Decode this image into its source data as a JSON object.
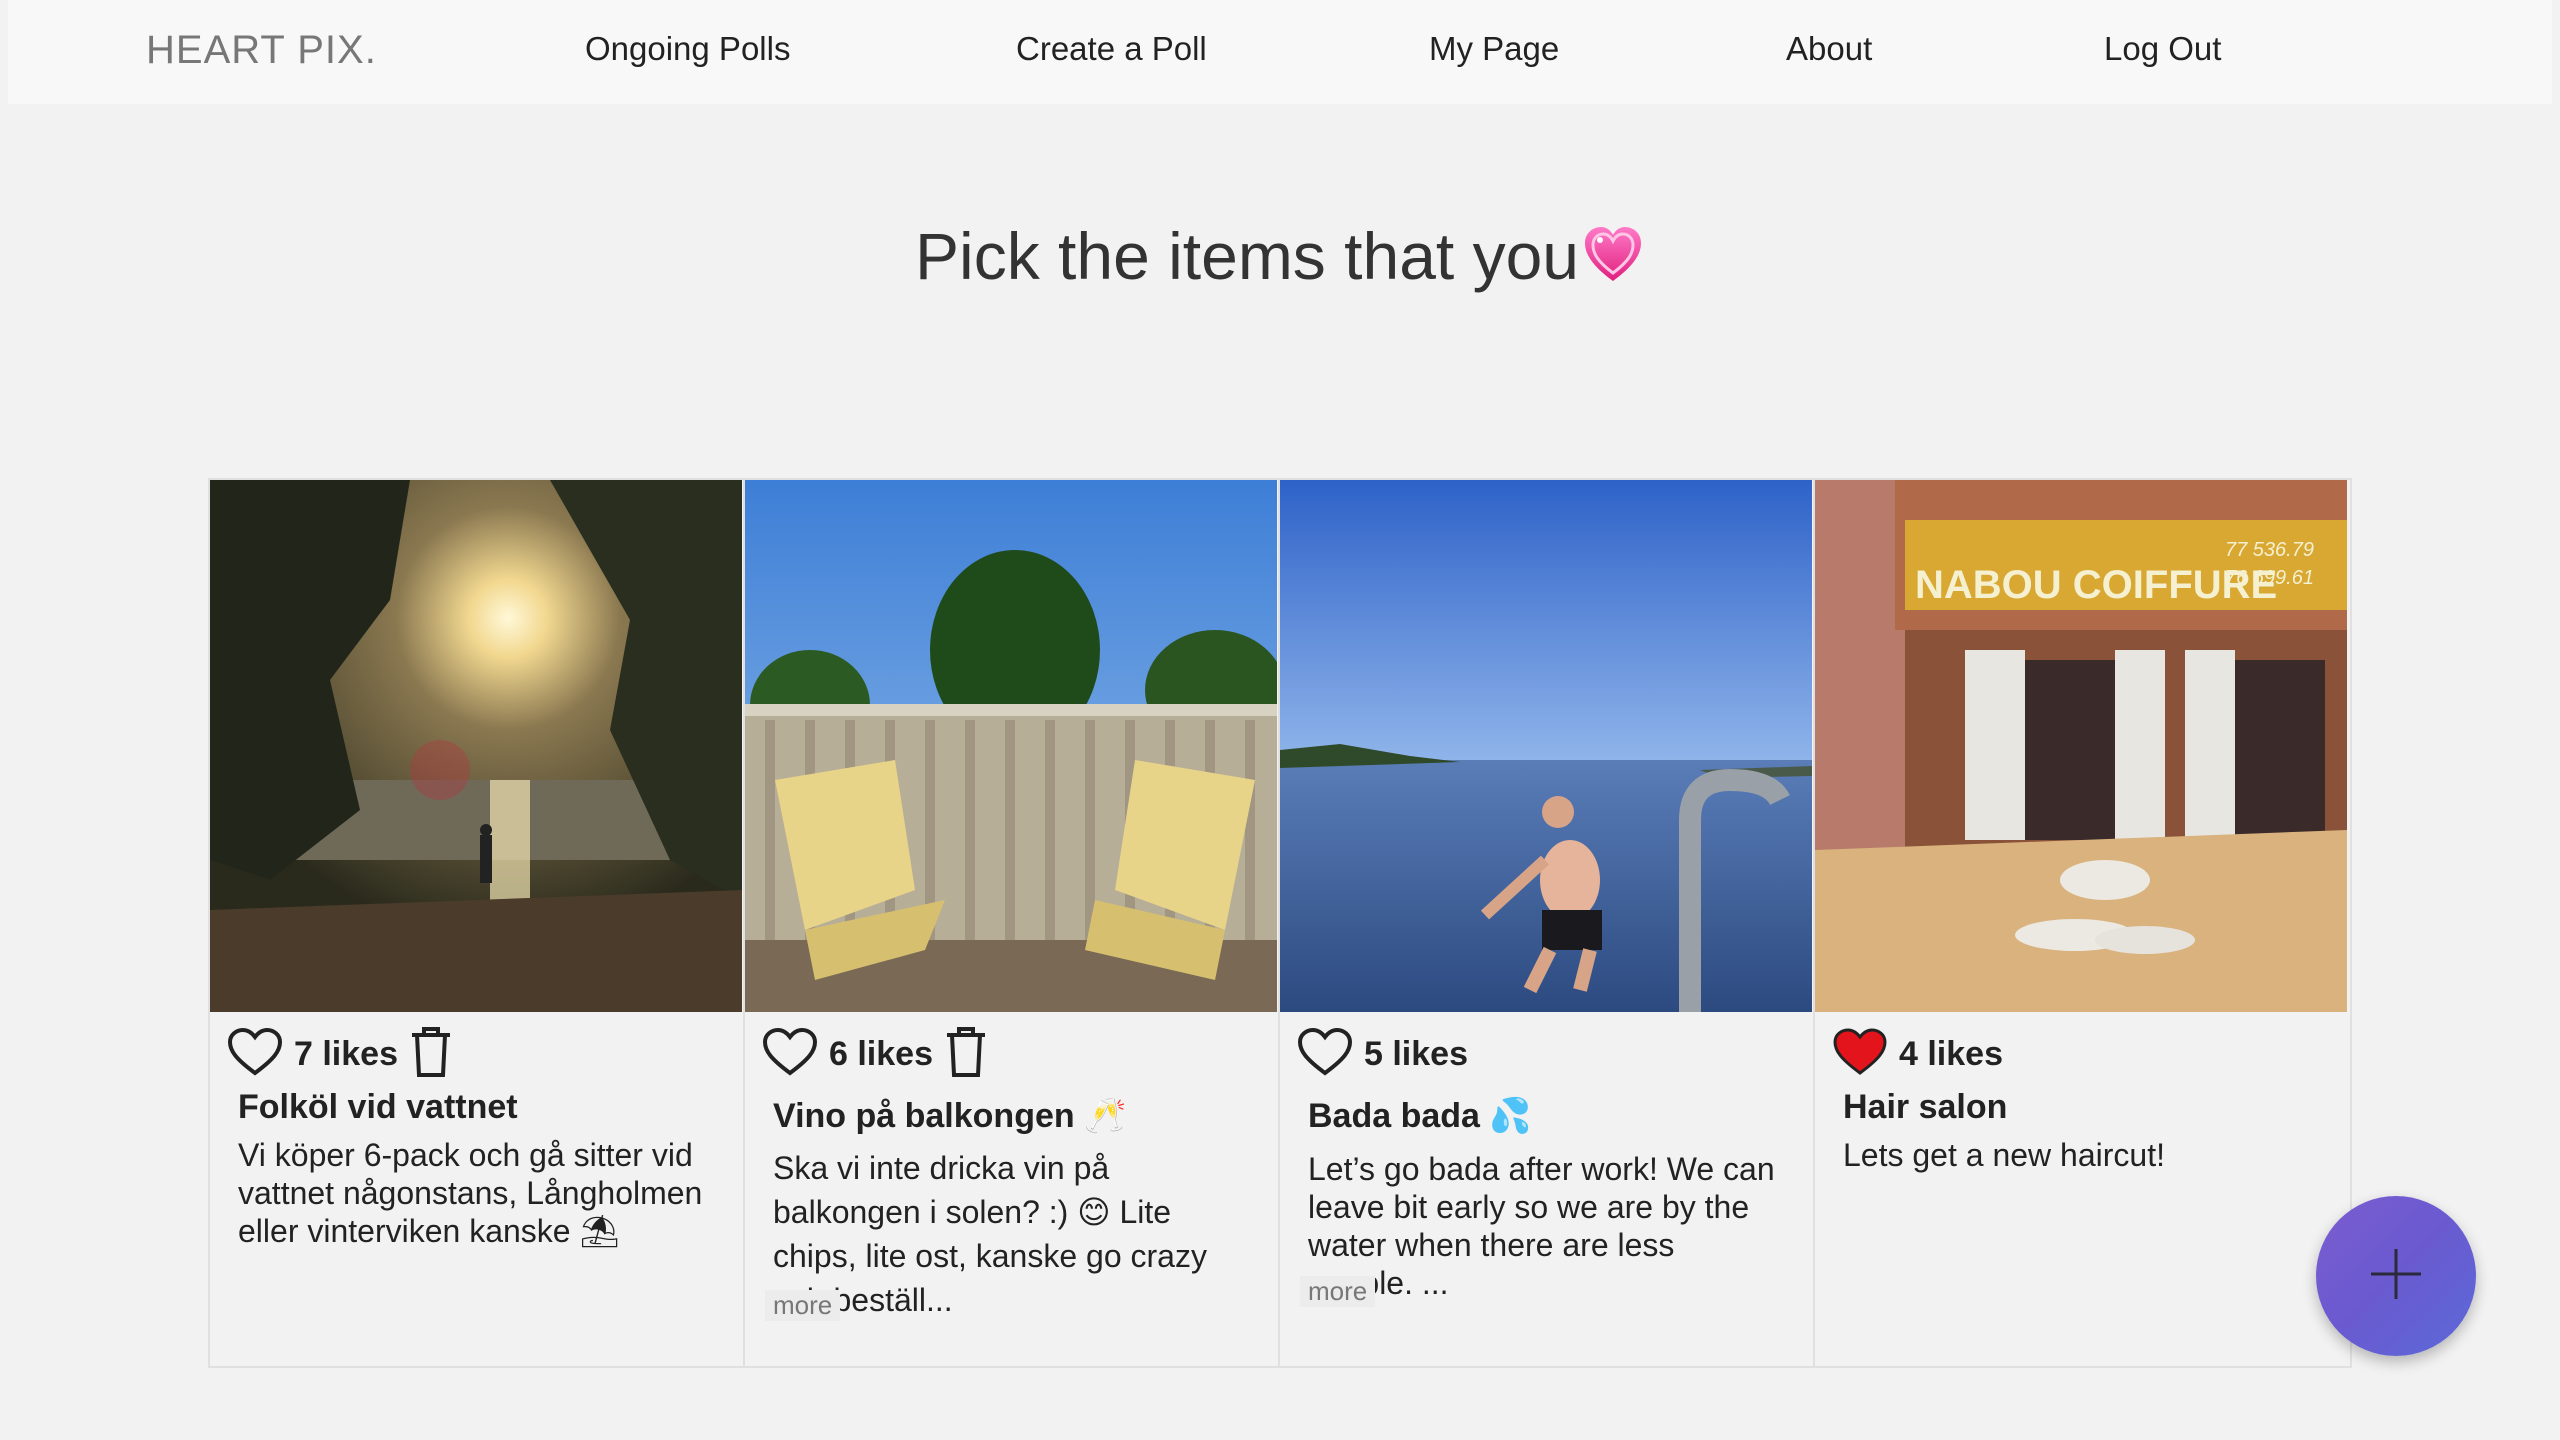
{
  "nav": {
    "brand": "HEART PIX.",
    "links": [
      "Ongoing Polls",
      "Create a Poll",
      "My Page",
      "About",
      "Log Out"
    ]
  },
  "page_title": "Pick the items that you",
  "cards": [
    {
      "likes": "7 likes",
      "liked": false,
      "deletable": true,
      "title": "Folköl vid vattnet",
      "description": "Vi köper 6-pack och gå sitter vid vattnet någonstans, Långholmen eller vinterviken kanske ⛱",
      "more": ""
    },
    {
      "likes": "6 likes",
      "liked": false,
      "deletable": true,
      "title": "Vino på balkongen 🥂",
      "description": "Ska vi inte dricka vin på balkongen i solen? :) 😊 Lite chips, lite ost, kanske go crazy och beställ...",
      "more": "more"
    },
    {
      "likes": "5 likes",
      "liked": false,
      "deletable": false,
      "title": "Bada bada 💦",
      "description": "Let’s go bada after work! We can leave bit early so we are by the water when there are less people. ...",
      "more": "more"
    },
    {
      "likes": "4 likes",
      "liked": true,
      "deletable": false,
      "title": "Hair salon",
      "description": "Lets get a new haircut!",
      "more": ""
    }
  ],
  "salon_sign": {
    "name": "NABOU COIFFURE",
    "phone1": "77 536.79",
    "phone2": "76 699.61"
  },
  "fab": {
    "icon": "plus-icon"
  },
  "colors": {
    "liked_heart": "#e3141b",
    "fab": "#6a5ad0"
  }
}
